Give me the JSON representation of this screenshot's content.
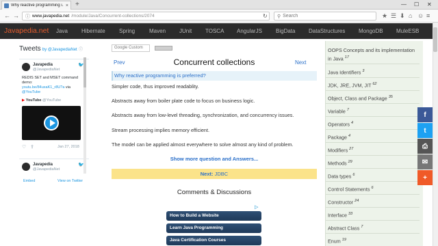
{
  "browser": {
    "tab_title": "Why reactive programming i...",
    "tab_close": "×",
    "new_tab": "+",
    "window_controls": [
      "—",
      "☐",
      "✕"
    ],
    "back": "←",
    "forward": "→",
    "url_host": "www.javapedia.net",
    "url_path": "/module/Java/Concurrent-collections/2074",
    "reload": "↻",
    "search_placeholder": "Search",
    "toolbar_icons": [
      "★",
      "☰",
      "⬇",
      "⌂",
      "☺",
      "≡"
    ]
  },
  "site": {
    "logo": "Javapedia.net",
    "nav": [
      "Java",
      "Hibernate",
      "Spring",
      "Maven",
      "JUnit",
      "TOSCA",
      "AngularJS",
      "BigData",
      "DataStructures",
      "MongoDB",
      "MuleESB"
    ]
  },
  "twitter": {
    "title": "Tweets",
    "by": "by @JavapediaNet",
    "name": "Javapedia",
    "handle": "@JavapediaNet",
    "text": "REDIS SET and MSET command demo:",
    "link": "youtu.be/84uxaK1_r8U?a",
    "via": "via",
    "via_link": "@YouTube",
    "yt_name": "YouTube",
    "yt_handle": "@YouTube",
    "date": "Jan 27, 2018",
    "name2": "Javapedia",
    "handle2": "@JavapediaNet",
    "embed": "Embed",
    "view_on": "View on Twitter"
  },
  "search": {
    "placeholder": "Google Custom"
  },
  "main": {
    "prev": "Prev",
    "next": "Next",
    "title": "Concurrent collections",
    "question": "Why reactive programming is preferred?",
    "paragraphs": [
      "Simpler code, thus improved readablity.",
      "Abstracts away from boiler plate code to focus on business logic.",
      "Abstracts away from low-level threading, synchronization, and concurrency issues.",
      "Stream processing implies memory efficient.",
      "The model can be applied almost everywhere to solve almost any kind of problem."
    ],
    "show_more": "Show more question and Answers...",
    "next_label": "Next:",
    "next_topic": "JDBC",
    "comments": "Comments & Discussions",
    "ads": [
      "How to Build a Website",
      "Learn Java Programming",
      "Java Certification Courses"
    ],
    "ad_choice": "▷"
  },
  "sidebar": {
    "items": [
      {
        "label": "OOPS Concepts and its implementation in Java",
        "count": "17"
      },
      {
        "label": "Java Identifiers",
        "count": "3"
      },
      {
        "label": "JDK, JRE, JVM, JIT",
        "count": "62"
      },
      {
        "label": "Object, Class and Package",
        "count": "35"
      },
      {
        "label": "Variable",
        "count": "7"
      },
      {
        "label": "Operators",
        "count": "4"
      },
      {
        "label": "Package",
        "count": "4"
      },
      {
        "label": "Modifiers",
        "count": "27"
      },
      {
        "label": "Methods",
        "count": "29"
      },
      {
        "label": "Data types",
        "count": "6"
      },
      {
        "label": "Control Statements",
        "count": "6"
      },
      {
        "label": "Constructor",
        "count": "24"
      },
      {
        "label": "Interface",
        "count": "33"
      },
      {
        "label": "Abstract Class",
        "count": "7"
      },
      {
        "label": "Enum",
        "count": "19"
      }
    ]
  },
  "share": [
    {
      "icon": "f",
      "color": "#3b5998"
    },
    {
      "icon": "t",
      "color": "#1da1f2"
    },
    {
      "icon": "⎙",
      "color": "#555555"
    },
    {
      "icon": "✉",
      "color": "#777777"
    },
    {
      "icon": "+",
      "color": "#f05a28"
    }
  ],
  "colors": {
    "logo": "#e85c2c",
    "nav_bg": "#2b2b2b",
    "link": "#2a6fc9",
    "next_bar": "#fbe38a",
    "sidebar_bg": "#edf3ea"
  }
}
